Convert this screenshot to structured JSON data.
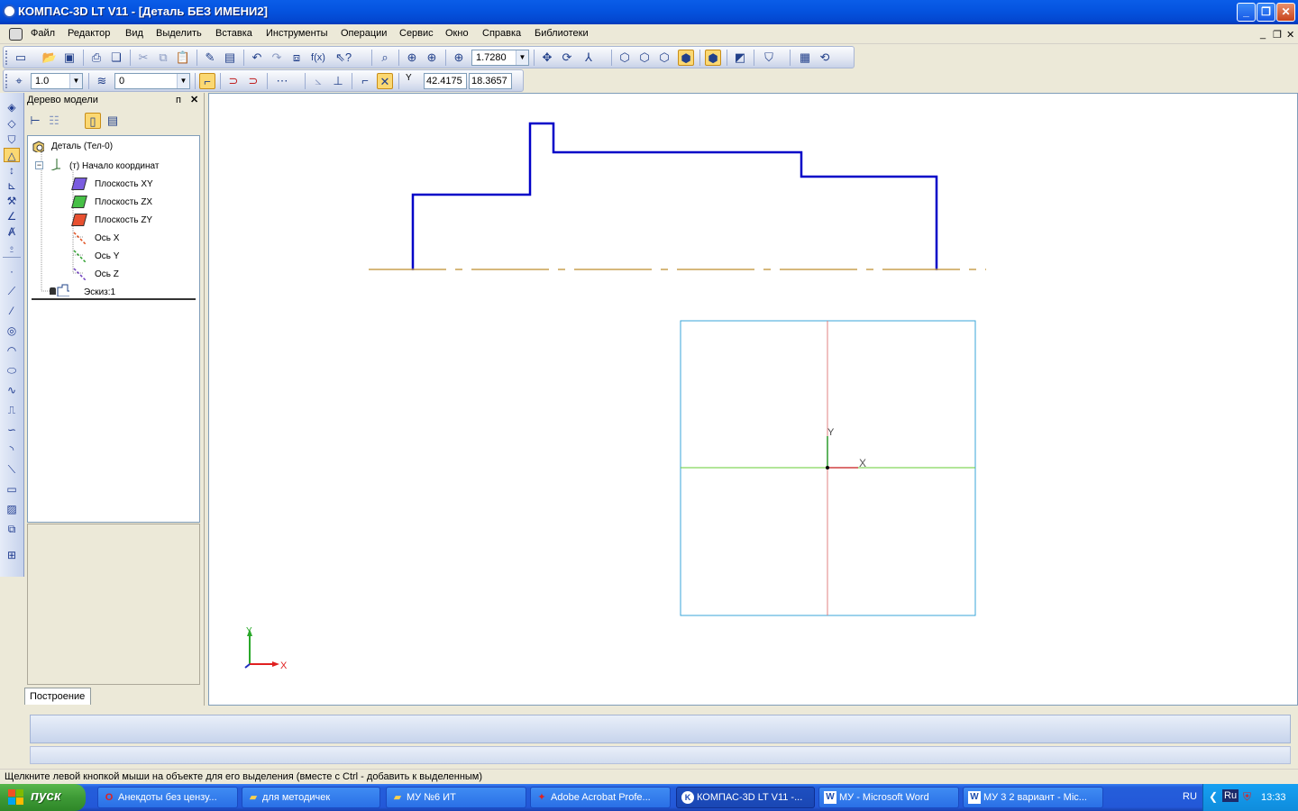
{
  "window": {
    "title": "КОМПАС-3D LT V11 - [Деталь БЕЗ ИМЕНИ2]",
    "minimize": "_",
    "restore": "❐",
    "close": "✕"
  },
  "menu": [
    "Файл",
    "Редактор",
    "Вид",
    "Выделить",
    "Вставка",
    "Инструменты",
    "Операции",
    "Сервис",
    "Окно",
    "Справка",
    "Библиотеки"
  ],
  "mdi_controls": {
    "minimize": "_",
    "restore": "❐",
    "close": "✕"
  },
  "toolbar1": {
    "zoom_value": "1.7280"
  },
  "toolbar2": {
    "step_value": "1.0",
    "layer_value": "0",
    "coord_y_label": "Y",
    "coord_x": "42.4175",
    "coord_y": "18.3657"
  },
  "tree": {
    "header": "Дерево модели",
    "pin": "ᴨ",
    "close": "✕",
    "items": [
      {
        "label": "Деталь (Тел-0)"
      },
      {
        "label": "(т) Начало координат",
        "toggle": "−"
      },
      {
        "label": "Плоскость XY"
      },
      {
        "label": "Плоскость ZX"
      },
      {
        "label": "Плоскость ZY"
      },
      {
        "label": "Ось X"
      },
      {
        "label": "Ось Y"
      },
      {
        "label": "Ось Z"
      },
      {
        "label": "Эскиз:1"
      }
    ],
    "tab": "Построение"
  },
  "canvas": {
    "origin_y_label": "Y",
    "origin_x_label": "X",
    "sketch_y_label": "Y",
    "sketch_x_label": "X"
  },
  "status": "Щелкните левой кнопкой мыши на объекте для его выделения (вместе с Ctrl - добавить к выделенным)",
  "taskbar": {
    "start": "пуск",
    "tasks": [
      {
        "label": "Анекдоты без цензу...",
        "icon": "opera-icon"
      },
      {
        "label": "для методичек",
        "icon": "folder-icon"
      },
      {
        "label": "МУ №6 ИТ",
        "icon": "folder-icon"
      },
      {
        "label": "Adobe Acrobat Profe...",
        "icon": "acrobat-icon"
      },
      {
        "label": "КОМПАС-3D LT V11 -...",
        "icon": "kompas-icon"
      },
      {
        "label": "МУ - Microsoft Word",
        "icon": "word-icon"
      },
      {
        "label": "МУ 3 2 вариант - Mic...",
        "icon": "word-icon"
      }
    ],
    "lang": "RU",
    "lang_badge": "Ru",
    "time": "13:33"
  },
  "colors": {
    "profile_line": "#0000c8",
    "axis_line": "#c8a050",
    "sketch_frame": "#3aa6d8",
    "sketch_h_axis": "#66cc33",
    "sketch_v_axis": "#e08080"
  }
}
